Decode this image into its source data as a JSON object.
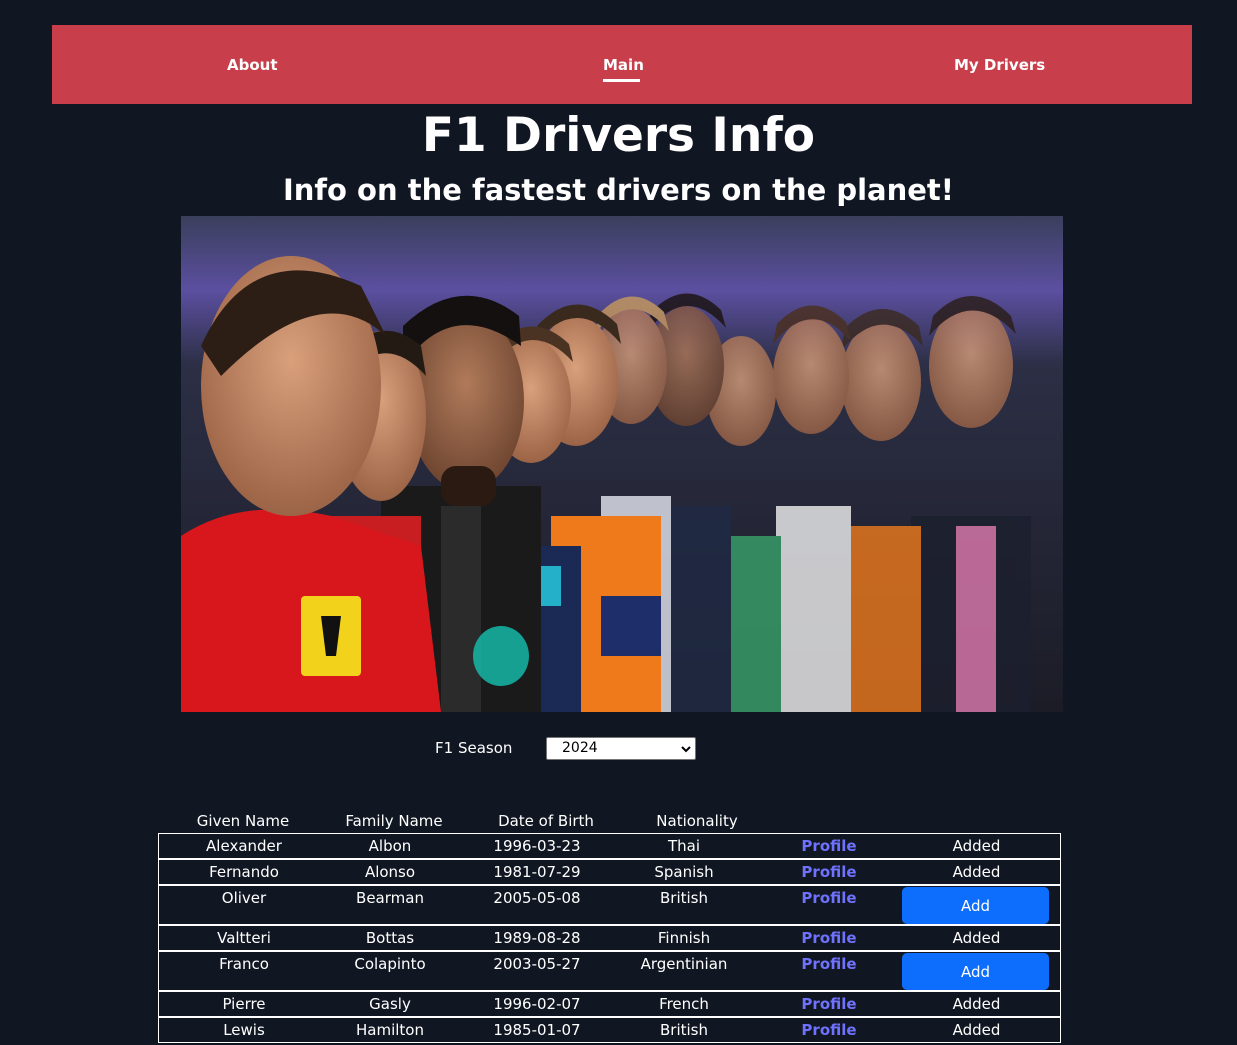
{
  "nav": {
    "about": "About",
    "main": "Main",
    "my_drivers": "My Drivers"
  },
  "header": {
    "title": "F1 Drivers Info",
    "subtitle": "Info on the fastest drivers on the planet!"
  },
  "season": {
    "label": "F1 Season",
    "selected": "2024"
  },
  "table": {
    "headers": [
      "Given Name",
      "Family Name",
      "Date of Birth",
      "Nationality"
    ],
    "profile_label": "Profile",
    "rows": [
      {
        "given": "Alexander",
        "family": "Albon",
        "dob": "1996-03-23",
        "nationality": "Thai",
        "status": "Added"
      },
      {
        "given": "Fernando",
        "family": "Alonso",
        "dob": "1981-07-29",
        "nationality": "Spanish",
        "status": "Added"
      },
      {
        "given": "Oliver",
        "family": "Bearman",
        "dob": "2005-05-08",
        "nationality": "British",
        "status": "Add"
      },
      {
        "given": "Valtteri",
        "family": "Bottas",
        "dob": "1989-08-28",
        "nationality": "Finnish",
        "status": "Added"
      },
      {
        "given": "Franco",
        "family": "Colapinto",
        "dob": "2003-05-27",
        "nationality": "Argentinian",
        "status": "Add"
      },
      {
        "given": "Pierre",
        "family": "Gasly",
        "dob": "1996-02-07",
        "nationality": "French",
        "status": "Added"
      },
      {
        "given": "Lewis",
        "family": "Hamilton",
        "dob": "1985-01-07",
        "nationality": "British",
        "status": "Added"
      }
    ]
  },
  "colors": {
    "background": "#111722",
    "nav_bg": "#c83e4b",
    "profile_link": "#6f71ff",
    "add_button": "#0d6efd"
  }
}
